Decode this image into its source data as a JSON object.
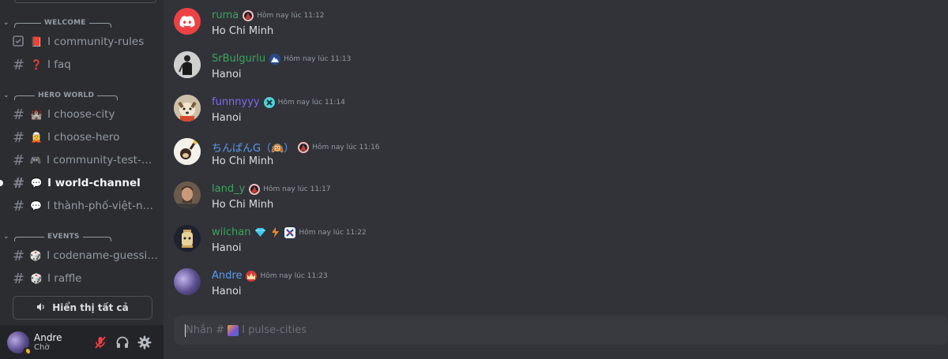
{
  "sidebar": {
    "categories": {
      "welcome": "WELCOME",
      "hero_world": "HERO WORLD",
      "events": "EVENTS"
    },
    "channels": [
      {
        "id": "community-rules",
        "label": "I community-rules",
        "emoji": "📕",
        "icon": "rules-checkbox-icon"
      },
      {
        "id": "faq",
        "label": "I faq",
        "emoji": "❓",
        "icon": "hash-icon"
      },
      {
        "id": "choose-city",
        "label": "I choose-city",
        "emoji": "🏰",
        "icon": "hash-icon"
      },
      {
        "id": "choose-hero",
        "label": "I choose-hero",
        "emoji": "🧝",
        "icon": "hash-icon"
      },
      {
        "id": "community-test",
        "label": "I community-test-di...",
        "emoji": "🎮",
        "icon": "hash-icon"
      },
      {
        "id": "world-channel",
        "label": "I world-channel",
        "emoji": "💬",
        "icon": "hash-icon",
        "active": true
      },
      {
        "id": "thanh-pho-viet-nam",
        "label": "I thành-phố-việt-nam",
        "emoji": "💬",
        "icon": "hash-icon"
      },
      {
        "id": "codename-guessing",
        "label": "I codename-guessing",
        "emoji": "🎲",
        "icon": "hash-icon"
      },
      {
        "id": "raffle",
        "label": "I raffle",
        "emoji": "🎲",
        "icon": "hash-icon"
      }
    ],
    "show_all": "Hiển thị tất cả"
  },
  "user": {
    "name": "Andre",
    "status": "Chờ"
  },
  "messages": [
    {
      "author": "ruma",
      "color": "#3ba55c",
      "time": "Hôm nay lúc 11:12",
      "text": "Ho Chi Minh"
    },
    {
      "author": "SrBulgurlu",
      "color": "#3ba55c",
      "time": "Hôm nay lúc 11:13",
      "text": "Hanoi"
    },
    {
      "author": "funnnyyy",
      "color": "#7b6cf6",
      "time": "Hôm nay lúc 11:14",
      "text": "Hanoi"
    },
    {
      "author": "ちんぱんG（🙉）",
      "color": "#5b9bf0",
      "time": "Hôm nay lúc 11:16",
      "text": "Ho Chi Minh"
    },
    {
      "author": "land_y",
      "color": "#3ba55c",
      "time": "Hôm nay lúc 11:17",
      "text": "Ho Chi Minh"
    },
    {
      "author": "wilchan",
      "color": "#3ba55c",
      "time": "Hôm nay lúc 11:22",
      "text": "Hanoi"
    },
    {
      "author": "Andre",
      "color": "#5b9bf0",
      "time": "Hôm nay lúc 11:23",
      "text": "Hanoi"
    }
  ],
  "composer": {
    "prefix": "Nhắn #",
    "channel": "I  pulse-cities"
  }
}
